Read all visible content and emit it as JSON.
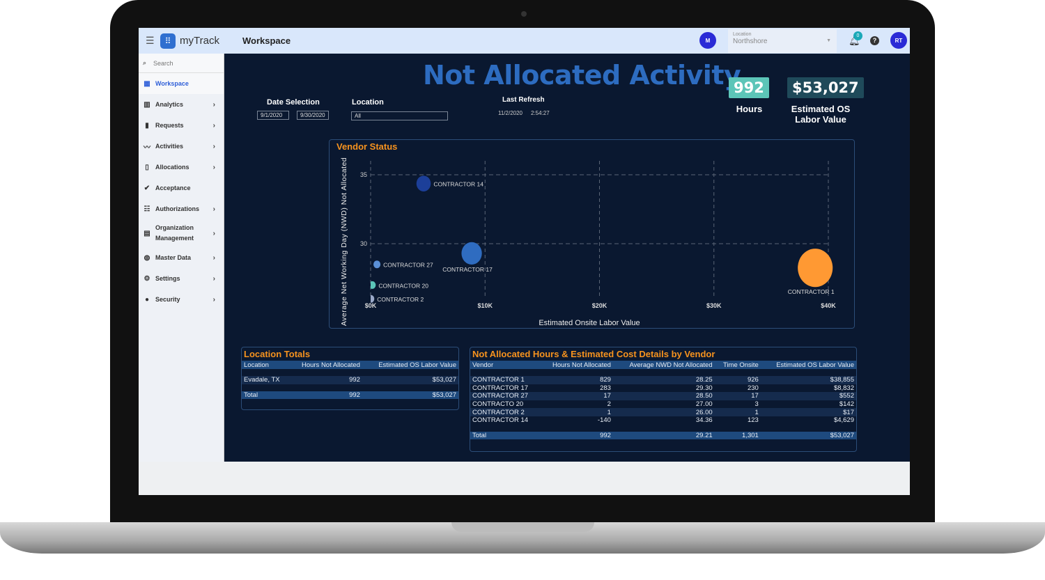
{
  "app": {
    "name": "myTrack",
    "page_title": "Workspace"
  },
  "header": {
    "user_m": "M",
    "location_label": "Location",
    "location_value": "Northshore",
    "notification_count": "0",
    "user_initials": "RT"
  },
  "sidebar": {
    "search_placeholder": "Search",
    "items": [
      {
        "label": "Workspace",
        "icon": "dashboard-icon",
        "active": true
      },
      {
        "label": "Analytics",
        "icon": "bar-chart-icon"
      },
      {
        "label": "Requests",
        "icon": "clipboard-alert-icon"
      },
      {
        "label": "Activities",
        "icon": "trend-icon"
      },
      {
        "label": "Allocations",
        "icon": "clipboard-icon"
      },
      {
        "label": "Acceptance",
        "icon": "check-circle-icon"
      },
      {
        "label": "Authorizations",
        "icon": "checklist-icon"
      },
      {
        "label": "Organization Management",
        "icon": "building-icon"
      },
      {
        "label": "Master Data",
        "icon": "globe-icon"
      },
      {
        "label": "Settings",
        "icon": "gear-icon"
      },
      {
        "label": "Security",
        "icon": "user-circle-icon"
      }
    ]
  },
  "dashboard": {
    "title": "Not Allocated Activity",
    "date_label": "Date Selection",
    "date_start": "9/1/2020",
    "date_end": "9/30/2020",
    "location_label": "Location",
    "location_value": "All",
    "refresh_label": "Last Refresh",
    "refresh_date": "11/2/2020",
    "refresh_time": "2:54:27",
    "kpi_hours": "992",
    "kpi_hours_label": "Hours",
    "kpi_value": "$53,027",
    "kpi_value_label": "Estimated OS Labor Value",
    "colors": {
      "title": "#2d6cc0",
      "accent": "#f7931e",
      "kpi_hours": "#5cc5b8",
      "kpi_value": "#1f4a5a"
    }
  },
  "chart_data": {
    "type": "scatter",
    "title": "Vendor Status",
    "xlabel": "Estimated Onsite Labor Value",
    "ylabel": "Average Net Working Day (NWD)  Not Allocated",
    "xlim": [
      0,
      40000
    ],
    "ylim": [
      26,
      36
    ],
    "xticks": [
      "$0K",
      "$10K",
      "$20K",
      "$30K",
      "$40K"
    ],
    "xtick_values": [
      0,
      10000,
      20000,
      30000,
      40000
    ],
    "yticks": [
      "30",
      "35"
    ],
    "ytick_values": [
      30,
      35
    ],
    "grid": true,
    "points": [
      {
        "label": "CONTRACTOR 14",
        "x": 4629,
        "y": 34.36,
        "size": 140,
        "color": "#1c3f99"
      },
      {
        "label": "CONTRACTOR 27",
        "x": 552,
        "y": 28.5,
        "size": 17,
        "color": "#5a8fd6"
      },
      {
        "label": "CONTRACTOR 17",
        "x": 8832,
        "y": 29.3,
        "size": 283,
        "color": "#2f6cc0"
      },
      {
        "label": "CONTRACTOR 20",
        "x": 142,
        "y": 27.0,
        "size": 2,
        "color": "#5cc5b8"
      },
      {
        "label": "CONTRACTOR 2",
        "x": 17,
        "y": 26.0,
        "size": 1,
        "color": "#9aa9c9"
      },
      {
        "label": "CONTRACTOR 1",
        "x": 38855,
        "y": 28.25,
        "size": 829,
        "color": "#ff9933"
      }
    ]
  },
  "location_totals": {
    "title": "Location Totals",
    "columns": [
      "Location",
      "Hours Not Allocated",
      "Estimated OS Labor Value"
    ],
    "rows": [
      [
        "Evadale, TX",
        "992",
        "$53,027"
      ]
    ],
    "total": [
      "Total",
      "992",
      "$53,027"
    ]
  },
  "vendor_details": {
    "title": "Not Allocated Hours & Estimated Cost Details by Vendor",
    "columns": [
      "Vendor",
      "Hours Not Allocated",
      "Average NWD Not Allocated",
      "Time Onsite",
      "Estimated OS Labor Value"
    ],
    "rows": [
      [
        "CONTRACTOR 1",
        "829",
        "28.25",
        "926",
        "$38,855"
      ],
      [
        "CONTRACTOR 17",
        "283",
        "29.30",
        "230",
        "$8,832"
      ],
      [
        "CONTRACTOR 27",
        "17",
        "28.50",
        "17",
        "$552"
      ],
      [
        "CONTRACTO 20",
        "2",
        "27.00",
        "3",
        "$142"
      ],
      [
        "CONTRACTOR 2",
        "1",
        "26.00",
        "1",
        "$17"
      ],
      [
        "CONTRACTOR 14",
        "-140",
        "34.36",
        "123",
        "$4,629"
      ]
    ],
    "total": [
      "Total",
      "992",
      "29.21",
      "1,301",
      "$53,027"
    ]
  }
}
